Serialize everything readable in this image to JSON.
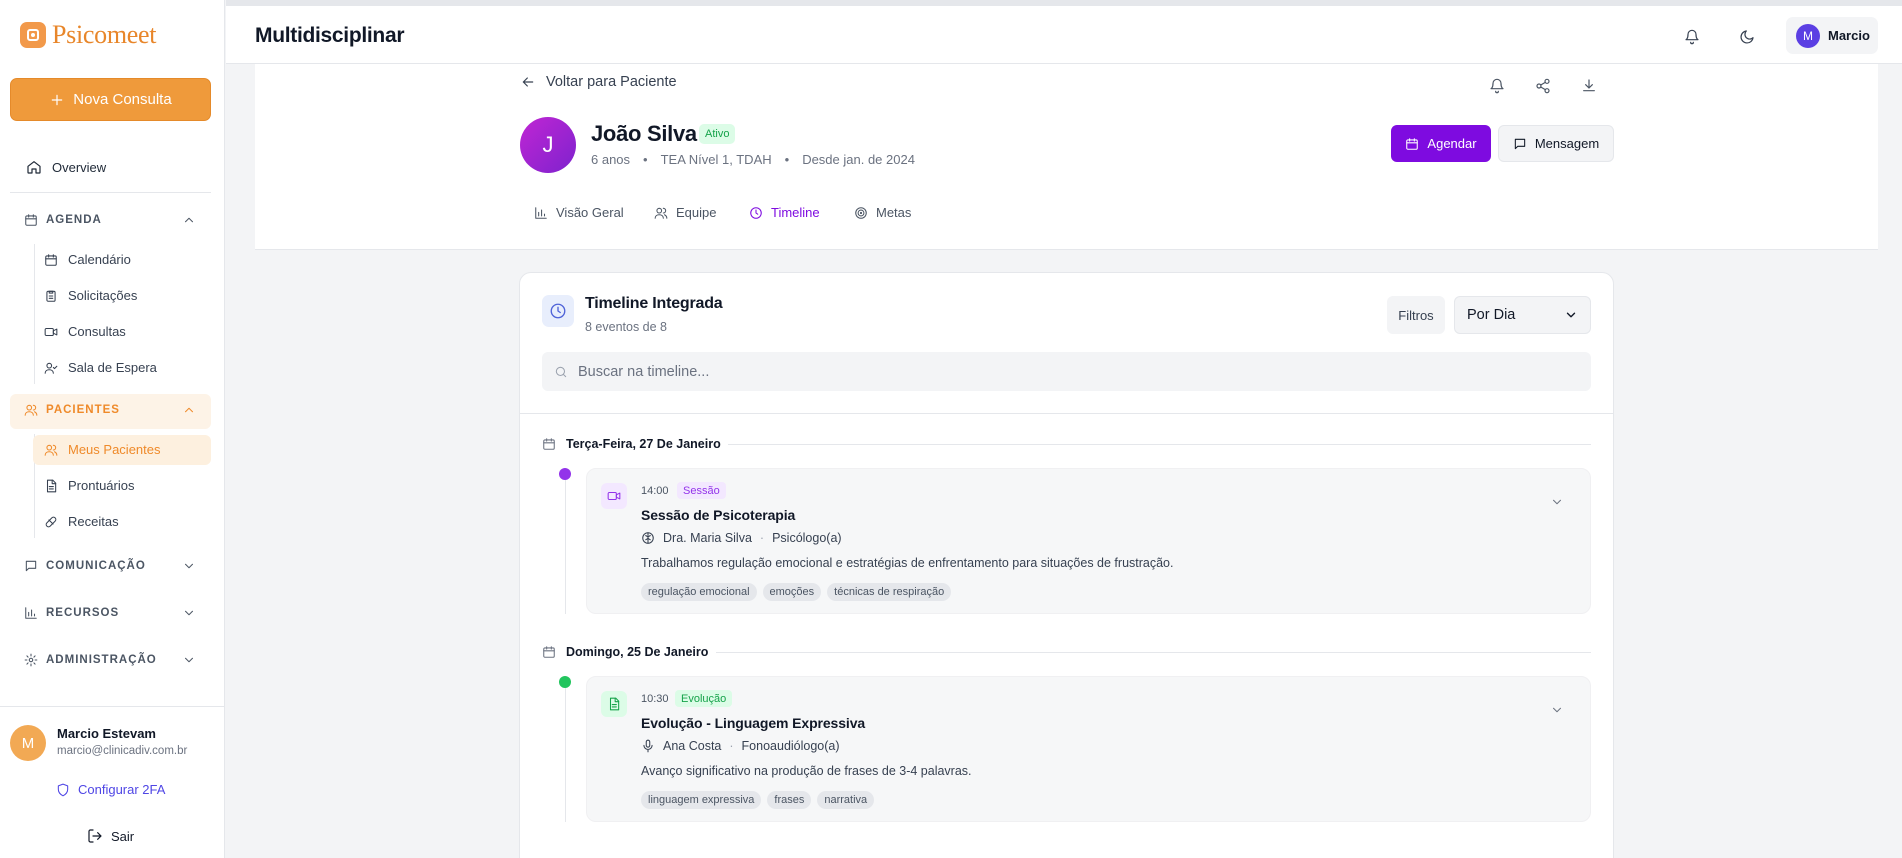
{
  "brand": {
    "name": "Psicomeet",
    "accent": "#ef9a3b"
  },
  "sidebar": {
    "new_button": "Nova Consulta",
    "overview": "Overview",
    "groups": {
      "agenda": {
        "label": "AGENDA",
        "items": [
          "Calendário",
          "Solicitações",
          "Consultas",
          "Sala de Espera"
        ]
      },
      "pacientes": {
        "label": "PACIENTES",
        "items": [
          "Meus Pacientes",
          "Prontuários",
          "Receitas"
        ]
      },
      "comunicacao": {
        "label": "COMUNICAÇÃO"
      },
      "recursos": {
        "label": "RECURSOS"
      },
      "administracao": {
        "label": "ADMINISTRAÇÃO"
      }
    },
    "user": {
      "initial": "M",
      "name": "Marcio Estevam",
      "email": "marcio@clinicadiv.com.br",
      "twofa": "Configurar 2FA",
      "logout": "Sair"
    }
  },
  "header": {
    "title": "Multidisciplinar",
    "user_initial": "M",
    "user_name": "Marcio"
  },
  "patient": {
    "back": "Voltar para Paciente",
    "initial": "J",
    "name": "João Silva",
    "status": "Ativo",
    "age": "6 anos",
    "diagnosis": "TEA Nível 1, TDAH",
    "since": "Desde jan. de 2024",
    "schedule_button": "Agendar",
    "message_button": "Mensagem",
    "tabs": [
      "Visão Geral",
      "Equipe",
      "Timeline",
      "Metas"
    ],
    "active_tab": "Timeline"
  },
  "timeline": {
    "title": "Timeline Integrada",
    "count": "8 eventos de 8",
    "filters": "Filtros",
    "group_by": "Por Dia",
    "search_placeholder": "Buscar na timeline...",
    "days": [
      {
        "label": "Terça-Feira, 27 De Janeiro",
        "event": {
          "time": "14:00",
          "type": "Sessão",
          "type_color": "#9333ea",
          "title": "Sessão de Psicoterapia",
          "professional": "Dra. Maria Silva",
          "role": "Psicólogo(a)",
          "description": "Trabalhamos regulação emocional e estratégias de enfrentamento para situações de frustração.",
          "tags": [
            "regulação emocional",
            "emoções",
            "técnicas de respiração"
          ]
        }
      },
      {
        "label": "Domingo, 25 De Janeiro",
        "event": {
          "time": "10:30",
          "type": "Evolução",
          "type_color": "#16a34a",
          "title": "Evolução - Linguagem Expressiva",
          "professional": "Ana Costa",
          "role": "Fonoaudiólogo(a)",
          "description": "Avanço significativo na produção de frases de 3-4 palavras.",
          "tags": [
            "linguagem expressiva",
            "frases",
            "narrativa"
          ]
        }
      }
    ]
  }
}
